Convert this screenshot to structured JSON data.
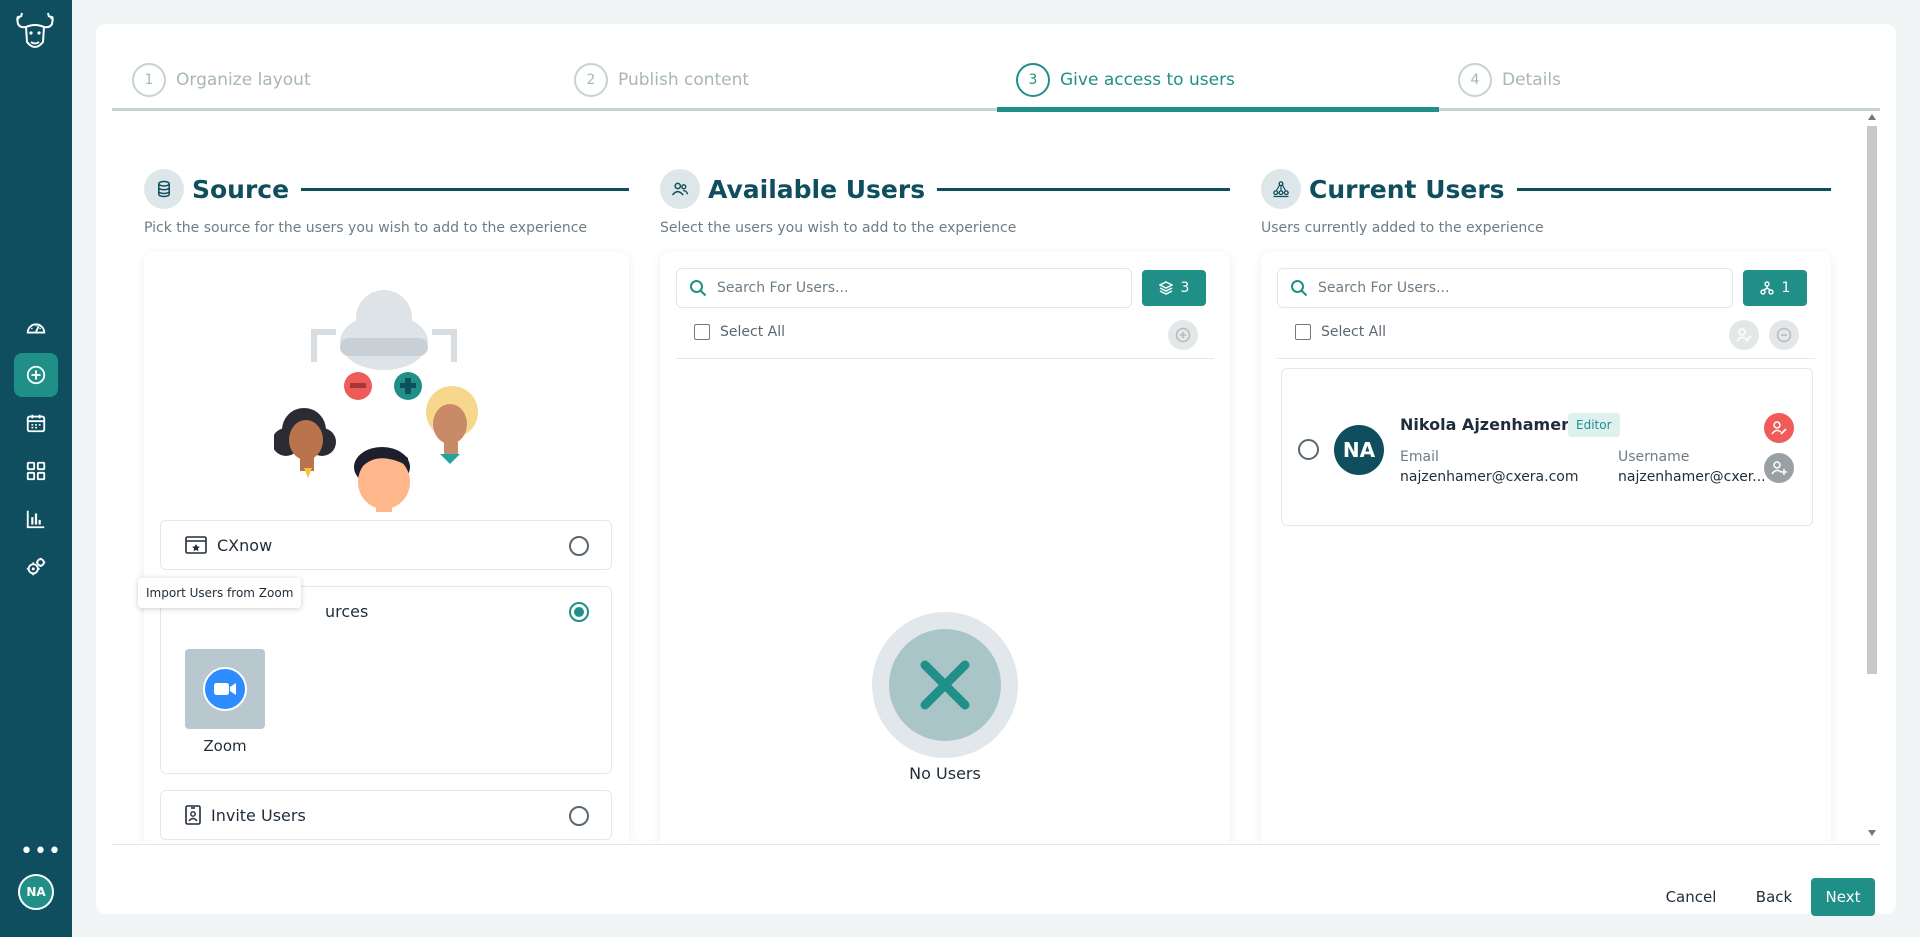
{
  "sidebar": {
    "items": [
      {
        "icon": "dashboard-icon"
      },
      {
        "icon": "add-circle-icon",
        "active": true
      },
      {
        "icon": "calendar-icon"
      },
      {
        "icon": "grid-icon"
      },
      {
        "icon": "bar-chart-icon"
      },
      {
        "icon": "settings-gears-icon"
      }
    ],
    "more": "•••",
    "user_initials": "NA"
  },
  "stepper": {
    "steps": [
      {
        "num": "1",
        "label": "Organize layout",
        "state": "done"
      },
      {
        "num": "2",
        "label": "Publish content",
        "state": "done"
      },
      {
        "num": "3",
        "label": "Give access to users",
        "state": "active"
      },
      {
        "num": "4",
        "label": "Details",
        "state": "upcoming"
      }
    ]
  },
  "source": {
    "title": "Source",
    "description": "Pick the source for the users you wish to add to the experience",
    "options": {
      "cxnow": {
        "label": "CXnow",
        "selected": false
      },
      "external": {
        "label": "External Sources",
        "visible_label": "urces",
        "selected": true,
        "tooltip": "Import Users from Zoom",
        "integration": "Zoom"
      },
      "invite": {
        "label": "Invite Users",
        "selected": false
      }
    }
  },
  "available": {
    "title": "Available Users",
    "description": "Select the users you wish to add to the experience",
    "search_placeholder": "Search For Users...",
    "count": "3",
    "select_all": "Select All",
    "empty_text": "No Users"
  },
  "current": {
    "title": "Current Users",
    "description": "Users currently added to the experience",
    "search_placeholder": "Search For Users...",
    "count": "1",
    "select_all": "Select All",
    "users": [
      {
        "initials": "NA",
        "name": "Nikola Ajzenhamer",
        "role": "Editor",
        "email_label": "Email",
        "email": "najzenhamer@cxera.com",
        "username_label": "Username",
        "username": "najzenhamer@cxer..."
      }
    ]
  },
  "footer": {
    "cancel": "Cancel",
    "back": "Back",
    "next": "Next"
  },
  "colors": {
    "sidebar": "#0f4e5e",
    "accent": "#1f8f88",
    "danger": "#ef5b59"
  }
}
